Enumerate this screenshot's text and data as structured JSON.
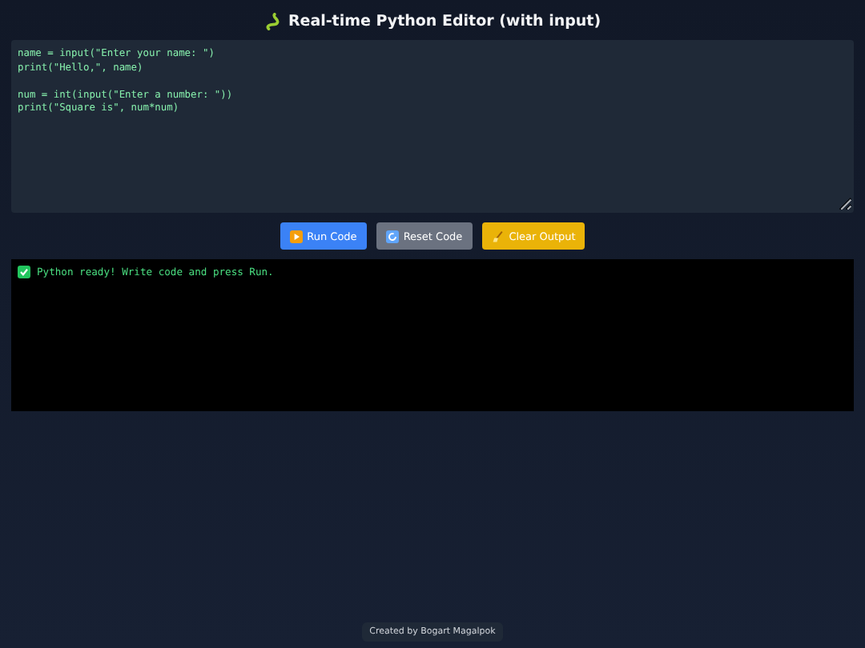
{
  "title": "Real-time Python Editor (with input)",
  "editor": {
    "value": "name = input(\"Enter your name: \")\nprint(\"Hello,\", name)\n\nnum = int(input(\"Enter a number: \"))\nprint(\"Square is\", num*num)"
  },
  "buttons": [
    {
      "kind": "run",
      "label": "Run Code"
    },
    {
      "kind": "reset",
      "label": "Reset Code"
    },
    {
      "kind": "clear",
      "label": "Clear Output"
    }
  ],
  "output": {
    "text": "Python ready! Write code and press Run."
  },
  "footer": "Created by Bogart Magalpok"
}
